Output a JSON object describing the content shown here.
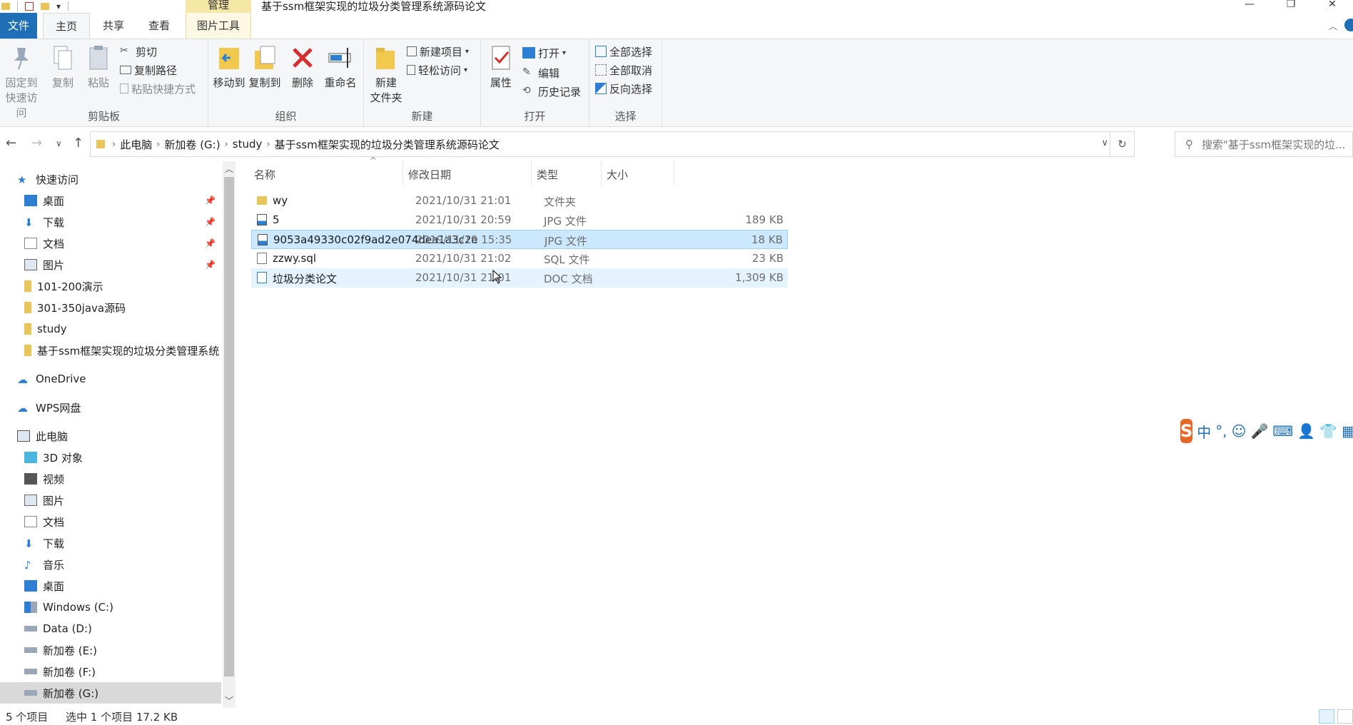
{
  "window": {
    "title": "基于ssm框架实现的垃圾分类管理系统源码论文",
    "context_tab": "管理",
    "controls": [
      "—",
      "❐",
      "✕"
    ]
  },
  "ribbon_tabs": {
    "file": "文件",
    "home": "主页",
    "share": "共享",
    "view": "查看",
    "picture_tools": "图片工具"
  },
  "ribbon": {
    "clipboard": {
      "group_label": "剪贴板",
      "pin_quick_access": "固定到\n快速访问",
      "pin_line1": "固定到",
      "pin_line2": "快速访问",
      "copy": "复制",
      "paste": "粘贴",
      "cut": "剪切",
      "copy_path": "复制路径",
      "paste_shortcut": "粘贴快捷方式"
    },
    "organize": {
      "group_label": "组织",
      "move_to": "移动到",
      "copy_to": "复制到",
      "delete": "删除",
      "rename": "重命名"
    },
    "new": {
      "group_label": "新建",
      "new_folder_line1": "新建",
      "new_folder_line2": "文件夹",
      "new_item": "新建项目",
      "easy_access": "轻松访问"
    },
    "open": {
      "group_label": "打开",
      "properties": "属性",
      "open": "打开",
      "edit": "编辑",
      "history": "历史记录"
    },
    "select": {
      "group_label": "选择",
      "select_all": "全部选择",
      "select_none": "全部取消",
      "invert_selection": "反向选择"
    }
  },
  "address": {
    "crumbs": [
      "此电脑",
      "新加卷 (G:)",
      "study",
      "基于ssm框架实现的垃圾分类管理系统源码论文"
    ],
    "search_placeholder": "搜索\"基于ssm框架实现的垃..."
  },
  "nav_pane": {
    "quick_access": "快速访问",
    "quick_items": [
      {
        "label": "桌面",
        "pinned": true
      },
      {
        "label": "下载",
        "pinned": true
      },
      {
        "label": "文档",
        "pinned": true
      },
      {
        "label": "图片",
        "pinned": true
      },
      {
        "label": "101-200演示",
        "pinned": false
      },
      {
        "label": "301-350java源码",
        "pinned": false
      },
      {
        "label": "study",
        "pinned": false
      },
      {
        "label": "基于ssm框架实现的垃圾分类管理系统",
        "pinned": false
      }
    ],
    "onedrive": "OneDrive",
    "wps": "WPS网盘",
    "this_pc": "此电脑",
    "pc_items": [
      "3D 对象",
      "视频",
      "图片",
      "文档",
      "下载",
      "音乐",
      "桌面",
      "Windows (C:)",
      "Data (D:)",
      "新加卷 (E:)",
      "新加卷 (F:)",
      "新加卷 (G:)"
    ]
  },
  "file_list": {
    "columns": {
      "name": "名称",
      "date": "修改日期",
      "type": "类型",
      "size": "大小"
    },
    "rows": [
      {
        "name": "wy",
        "date": "2021/10/31 21:01",
        "type": "文件夹",
        "size": "",
        "icon": "folder-icon"
      },
      {
        "name": "5",
        "date": "2021/10/31 20:59",
        "type": "JPG 文件",
        "size": "189 KB",
        "icon": "image-file-icon"
      },
      {
        "name": "9053a49330c02f9ad2e074dea1a3c2e",
        "date": "2019/11/19 15:35",
        "type": "JPG 文件",
        "size": "18 KB",
        "icon": "image-file-icon"
      },
      {
        "name": "zzwy.sql",
        "date": "2021/10/31 21:02",
        "type": "SQL 文件",
        "size": "23 KB",
        "icon": "generic-file-icon"
      },
      {
        "name": "垃圾分类论文",
        "date": "2021/10/31 21:01",
        "type": "DOC 文档",
        "size": "1,309 KB",
        "icon": "doc-file-icon"
      }
    ]
  },
  "ime": {
    "logo": "S",
    "mode": "中",
    "punct": "°,"
  },
  "status": {
    "item_count": "5 个项目",
    "selection": "选中 1 个项目  17.2 KB"
  },
  "colors": {
    "accent": "#1e6fb5",
    "selection": "#cce8ff",
    "context_tab": "#f5e7a6"
  }
}
